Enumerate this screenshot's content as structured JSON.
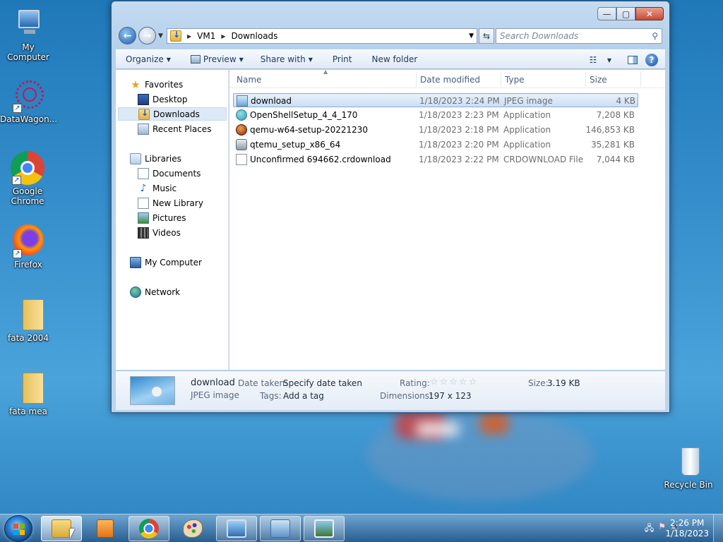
{
  "desktop": {
    "icons": [
      {
        "label": "My Computer"
      },
      {
        "label": "DataWagon..."
      },
      {
        "label": "Google Chrome"
      },
      {
        "label": "Firefox"
      },
      {
        "label": "fata 2004"
      },
      {
        "label": "fata mea"
      },
      {
        "label": "Recycle Bin"
      }
    ]
  },
  "window": {
    "controls": {
      "minimize": "—",
      "maximize": "▢",
      "close": "✕"
    },
    "address": {
      "crumbs": [
        "VM1",
        "Downloads"
      ]
    },
    "search": {
      "placeholder": "Search Downloads"
    },
    "toolbar": {
      "organize": "Organize",
      "preview": "Preview",
      "share_with": "Share with",
      "print": "Print",
      "new_folder": "New folder"
    },
    "nav": {
      "favorites": "Favorites",
      "desktop": "Desktop",
      "downloads": "Downloads",
      "recent_places": "Recent Places",
      "libraries": "Libraries",
      "documents": "Documents",
      "music": "Music",
      "new_library": "New Library",
      "pictures": "Pictures",
      "videos": "Videos",
      "my_computer": "My Computer",
      "network": "Network"
    },
    "columns": {
      "name": "Name",
      "date_modified": "Date modified",
      "type": "Type",
      "size": "Size"
    },
    "files": [
      {
        "name": "download",
        "date": "1/18/2023 2:24 PM",
        "type": "JPEG image",
        "size": "4 KB",
        "icon": "jpeg-icon",
        "selected": true
      },
      {
        "name": "OpenShellSetup_4_4_170",
        "date": "1/18/2023 2:23 PM",
        "type": "Application",
        "size": "7,208 KB",
        "icon": "openshell-icon"
      },
      {
        "name": "qemu-w64-setup-20221230",
        "date": "1/18/2023 2:18 PM",
        "type": "Application",
        "size": "146,853 KB",
        "icon": "qemu-icon"
      },
      {
        "name": "qtemu_setup_x86_64",
        "date": "1/18/2023 2:20 PM",
        "type": "Application",
        "size": "35,281 KB",
        "icon": "qtemu-icon"
      },
      {
        "name": "Unconfirmed 694662.crdownload",
        "date": "1/18/2023 2:22 PM",
        "type": "CRDOWNLOAD File",
        "size": "7,044 KB",
        "icon": "file-icon"
      }
    ],
    "details": {
      "name": "download",
      "type": "JPEG image",
      "date_taken_label": "Date taken:",
      "date_taken_value": "Specify date taken",
      "tags_label": "Tags:",
      "tags_value": "Add a tag",
      "rating_label": "Rating:",
      "rating_stars": "☆☆☆☆☆",
      "dimensions_label": "Dimensions:",
      "dimensions_value": "197 x 123",
      "size_label": "Size:",
      "size_value": "3.19 KB"
    }
  },
  "taskbar": {
    "clock_time": "2:26 PM",
    "clock_date": "1/18/2023"
  }
}
